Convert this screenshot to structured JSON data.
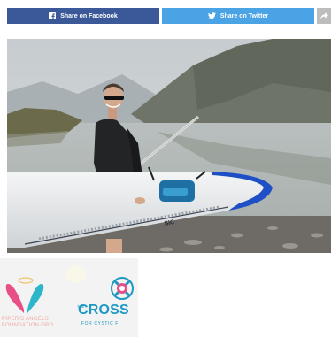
{
  "share": {
    "facebook_label": "Share on Facebook",
    "twitter_label": "Share on Twitter",
    "facebook_color": "#3b5998",
    "twitter_color": "#4aa3e4",
    "more_color": "#bdbdbd",
    "facebook_icon": "facebook-icon",
    "twitter_icon": "twitter-icon",
    "more_icon": "share-arrow-icon"
  },
  "logos": {
    "pipers_line1": "PIPER'S ANGELS",
    "pipers_line2": "FOUNDATION.ORG",
    "cross_the": "THE",
    "cross_word": "CROSS",
    "cross_sub": "FOR CYSTIC F"
  }
}
